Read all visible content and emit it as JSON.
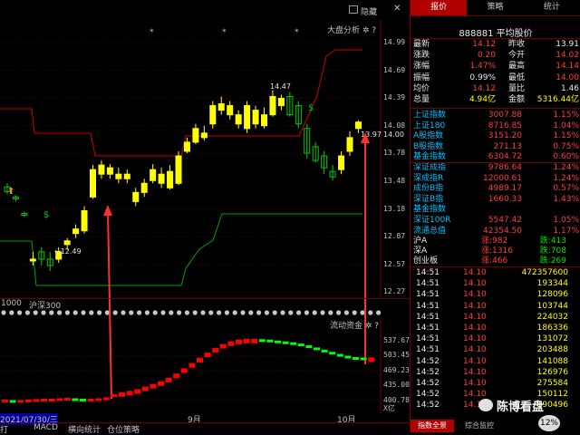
{
  "chart": {
    "toolbar_label": "隐藏",
    "overlay_title": "大盘分析",
    "price_ticks": [
      "14.99",
      "14.69",
      "14.39",
      "14.08",
      "13.78",
      "13.48",
      "13.18",
      "12.87",
      "12.57",
      "12.27"
    ],
    "annotation_high": "14.47",
    "annotation_low": "12.49",
    "annotation_current": "13.97",
    "annotation_current_right": "14.00",
    "index_bar_left": "1000",
    "index_bar_name": "沪深300",
    "ind_title": "流动资金",
    "ind_ticks": [
      "537.67",
      "503.45",
      "469.23",
      "435.00",
      "400.78"
    ],
    "ind_unit": "X亿",
    "x_labels": [
      "9月",
      "10月"
    ],
    "date_start": "2021/07/30/三",
    "bottom_tabs": [
      "打",
      "MACD",
      "横向统计",
      "仓位策略"
    ],
    "ma_colors": {
      "ma1": "#cc0000",
      "ma2": "#00a000"
    },
    "candle_up": "#ffff00",
    "candle_down": "#00cc00",
    "ind_up": "#ff0000",
    "ind_down": "#00ff00"
  },
  "quote": {
    "tabs": [
      "报价",
      "策略",
      "统计"
    ],
    "code_name": "888881 平均股价",
    "rows": [
      [
        {
          "t": "最新",
          "c": "white"
        },
        {
          "t": "14.12",
          "c": "red"
        },
        {
          "t": "昨收",
          "c": "white"
        },
        {
          "t": "13.91",
          "c": "white"
        }
      ],
      [
        {
          "t": "涨跌",
          "c": "white"
        },
        {
          "t": "0.20",
          "c": "red"
        },
        {
          "t": "今开",
          "c": "white"
        },
        {
          "t": "14.02",
          "c": "red"
        }
      ],
      [
        {
          "t": "涨幅",
          "c": "white"
        },
        {
          "t": "1.47%",
          "c": "red"
        },
        {
          "t": "最高",
          "c": "white"
        },
        {
          "t": "14.14",
          "c": "red"
        }
      ],
      [
        {
          "t": "振幅",
          "c": "white"
        },
        {
          "t": "0.99%",
          "c": "white"
        },
        {
          "t": "最低",
          "c": "white"
        },
        {
          "t": "14.00",
          "c": "red"
        }
      ],
      [
        {
          "t": "均价",
          "c": "white"
        },
        {
          "t": "14.12",
          "c": "red"
        },
        {
          "t": "量比",
          "c": "white"
        },
        {
          "t": "1.46",
          "c": "white"
        }
      ],
      [
        {
          "t": "总量",
          "c": "white"
        },
        {
          "t": "4.94亿",
          "c": "yellow"
        },
        {
          "t": "金额",
          "c": "white"
        },
        {
          "t": "5316.44亿",
          "c": "yellow"
        }
      ]
    ],
    "indices": [
      {
        "n": "上证指数",
        "v": "3007.88",
        "p": "1.15%",
        "c": "red"
      },
      {
        "n": "上证180",
        "v": "8716.85",
        "p": "1.04%",
        "c": "red"
      },
      {
        "n": "A股指数",
        "v": "3151.20",
        "p": "1.15%",
        "c": "red"
      },
      {
        "n": "B股指数",
        "v": "271.13",
        "p": "0.75%",
        "c": "red"
      },
      {
        "n": "基金指数",
        "v": "6304.72",
        "p": "0.60%",
        "c": "red"
      },
      {
        "n": "深证成指",
        "v": "9786.64",
        "p": "1.24%",
        "c": "red"
      },
      {
        "n": "深成指R",
        "v": "12000.61",
        "p": "1.24%",
        "c": "red"
      },
      {
        "n": "成份B指",
        "v": "4989.17",
        "p": "0.57%",
        "c": "red"
      },
      {
        "n": "深证B指",
        "v": "1660.33",
        "p": "1.43%",
        "c": "red"
      },
      {
        "n": "基金指数",
        "v": "",
        "p": "",
        "c": "red"
      },
      {
        "n": "深证100R",
        "v": "5547.42",
        "p": "1.05%",
        "c": "red"
      },
      {
        "n": "流通总值",
        "v": "42354.50",
        "p": "1.17%",
        "c": "red"
      }
    ],
    "breadth": [
      {
        "n": "沪A",
        "up": "涨:982",
        "dn": "跌:413"
      },
      {
        "n": "深A",
        "up": "涨:1316",
        "dn": "跌:708"
      },
      {
        "n": "创业板",
        "up": "涨:466",
        "dn": "跌:269"
      }
    ],
    "ticks": [
      {
        "t": "14:51",
        "p": "14.10",
        "v": "472357600"
      },
      {
        "t": "14:51",
        "p": "14.10",
        "v": "193344"
      },
      {
        "t": "14:51",
        "p": "14.10",
        "v": "128096"
      },
      {
        "t": "14:51",
        "p": "14.10",
        "v": "103744"
      },
      {
        "t": "14:51",
        "p": "14.10",
        "v": "224032"
      },
      {
        "t": "14:51",
        "p": "14.10",
        "v": "186336"
      },
      {
        "t": "14:51",
        "p": "14.10",
        "v": "131072"
      },
      {
        "t": "14:51",
        "p": "14.10",
        "v": "203488"
      },
      {
        "t": "14:52",
        "p": "14.10",
        "v": "141088"
      },
      {
        "t": "14:52",
        "p": "14.10",
        "v": "126976"
      },
      {
        "t": "14:52",
        "p": "14.10",
        "v": "275584"
      },
      {
        "t": "14:52",
        "p": "14.10",
        "v": "150112"
      },
      {
        "t": "14:52",
        "p": "14.10",
        "v": "190496"
      }
    ],
    "bottom_tabs": [
      "指数全景",
      "综合监控"
    ],
    "watermark": "陈博看盘",
    "progress_label": "12%"
  }
}
